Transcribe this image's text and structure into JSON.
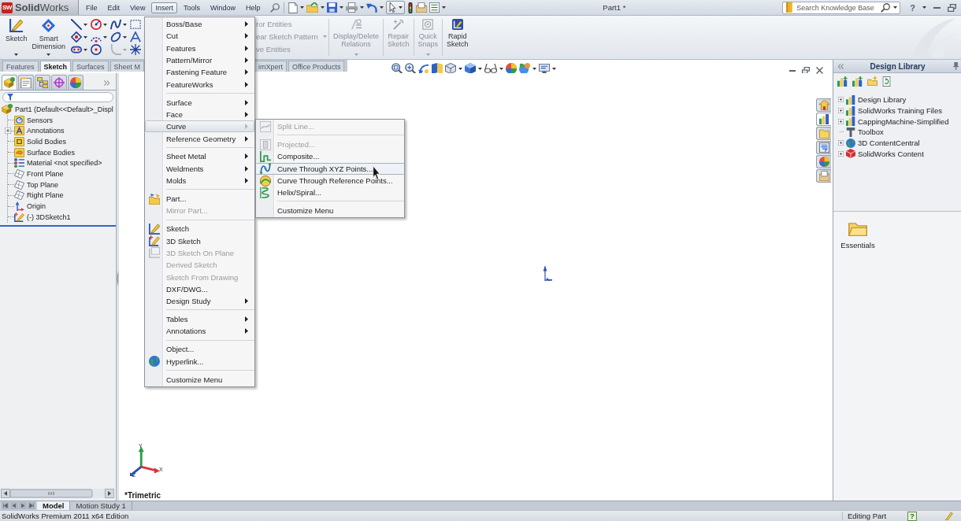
{
  "title_bar": {
    "logo_mark": "SW",
    "logo": "**Solid**Works",
    "menus": [
      {
        "label": "File",
        "selected": false
      },
      {
        "label": "Edit",
        "selected": false
      },
      {
        "label": "View",
        "selected": false
      },
      {
        "label": "Insert",
        "selected": true
      },
      {
        "label": "Tools",
        "selected": false
      },
      {
        "label": "Window",
        "selected": false
      },
      {
        "label": "Help",
        "selected": false
      }
    ],
    "document_title": "Part1 *",
    "search": {
      "placeholder": "Search Knowledge Base"
    },
    "help": "?"
  },
  "command_manager": {
    "large_buttons": [
      {
        "label": "Sketch",
        "dropdown": true
      },
      {
        "label": "Smart Dimension",
        "dropdown": true
      }
    ],
    "partial_commands": [
      {
        "label": "ror Entities",
        "disabled": true,
        "dropdown": false
      },
      {
        "label": "ear Sketch Pattern",
        "disabled": true,
        "dropdown": true
      },
      {
        "label": "ve Entities",
        "disabled": true,
        "dropdown": false
      }
    ],
    "tools": [
      {
        "label": "Display/Delete Relations",
        "disabled": true,
        "dropdown": true
      },
      {
        "label": "Repair Sketch",
        "disabled": true,
        "dropdown": false
      },
      {
        "label": "Quick Snaps",
        "disabled": true,
        "dropdown": true
      },
      {
        "label": "Rapid Sketch",
        "disabled": false,
        "dropdown": false
      }
    ]
  },
  "tabs": [
    {
      "label": "Features",
      "selected": false
    },
    {
      "label": "Sketch",
      "selected": true
    },
    {
      "label": "Surfaces",
      "selected": false
    },
    {
      "label": "Sheet M",
      "selected": false
    },
    {
      "label": "imXpert",
      "selected": false
    },
    {
      "label": "Office Products",
      "selected": false
    }
  ],
  "feature_manager": {
    "panel_tabs": [
      {
        "selected": true
      },
      {
        "selected": false
      },
      {
        "selected": false
      },
      {
        "selected": false
      },
      {
        "selected": false
      }
    ],
    "tree": {
      "label": "Part1 (Default<<Default>_Displ",
      "children": [
        {
          "label": "Sensors"
        },
        {
          "label": "Annotations",
          "expanded": false
        },
        {
          "label": "Solid Bodies"
        },
        {
          "label": "Surface Bodies"
        },
        {
          "label": "Material <not specified>"
        },
        {
          "label": "Front Plane"
        },
        {
          "label": "Top Plane"
        },
        {
          "label": "Right Plane"
        },
        {
          "label": "Origin"
        },
        {
          "label": "(-) 3DSketch1"
        }
      ]
    }
  },
  "viewport": {
    "view_name": "*Trimetric",
    "triad_axes": [
      "Y",
      "X",
      "Z"
    ]
  },
  "task_pane": {
    "tabs": [
      {
        "selected": false
      },
      {
        "selected": true
      },
      {
        "selected": false
      },
      {
        "selected": false
      },
      {
        "selected": false
      },
      {
        "selected": false
      }
    ],
    "title": "Design Library",
    "items": [
      {
        "label": "Design Library",
        "expanded": false
      },
      {
        "label": "SolidWorks Training Files",
        "expanded": false
      },
      {
        "label": "CappingMachine-Simplified",
        "expanded": false
      },
      {
        "label": "Toolbox"
      },
      {
        "label": "3D ContentCentral",
        "expanded": false
      },
      {
        "label": "SolidWorks Content",
        "expanded": false
      }
    ],
    "folders": [
      {
        "label": "Essentials"
      }
    ]
  },
  "insert_menu": {
    "groups": [
      [
        {
          "label": "Boss/Base",
          "submenu": true,
          "disabled": false,
          "selected": false
        },
        {
          "label": "Cut",
          "submenu": true,
          "disabled": false,
          "selected": false
        },
        {
          "label": "Features",
          "submenu": true,
          "disabled": false,
          "selected": false
        },
        {
          "label": "Pattern/Mirror",
          "submenu": true,
          "disabled": false,
          "selected": false
        },
        {
          "label": "Fastening Feature",
          "submenu": true,
          "disabled": false,
          "selected": false
        },
        {
          "label": "FeatureWorks",
          "submenu": true,
          "disabled": false,
          "selected": false
        }
      ],
      [
        {
          "label": "Surface",
          "submenu": true,
          "disabled": false,
          "selected": false
        },
        {
          "label": "Face",
          "submenu": true,
          "disabled": false,
          "selected": false
        },
        {
          "label": "Curve",
          "submenu": true,
          "disabled": false,
          "selected": true
        },
        {
          "label": "Reference Geometry",
          "submenu": true,
          "disabled": false,
          "selected": false
        }
      ],
      [
        {
          "label": "Sheet Metal",
          "submenu": true,
          "disabled": false,
          "selected": false
        },
        {
          "label": "Weldments",
          "submenu": true,
          "disabled": false,
          "selected": false
        },
        {
          "label": "Molds",
          "submenu": true,
          "disabled": false,
          "selected": false
        }
      ],
      [
        {
          "label": "Part...",
          "submenu": false,
          "disabled": false,
          "selected": false
        },
        {
          "label": "Mirror Part...",
          "submenu": false,
          "disabled": true,
          "selected": false
        }
      ],
      [
        {
          "label": "Sketch",
          "submenu": false,
          "disabled": false,
          "selected": false
        },
        {
          "label": "3D Sketch",
          "submenu": false,
          "disabled": false,
          "selected": false
        },
        {
          "label": "3D Sketch On Plane",
          "submenu": false,
          "disabled": true,
          "selected": false
        },
        {
          "label": "Derived Sketch",
          "submenu": false,
          "disabled": true,
          "selected": false
        },
        {
          "label": "Sketch From Drawing",
          "submenu": false,
          "disabled": true,
          "selected": false
        },
        {
          "label": "DXF/DWG...",
          "submenu": false,
          "disabled": false,
          "selected": false
        },
        {
          "label": "Design Study",
          "submenu": true,
          "disabled": false,
          "selected": false
        }
      ],
      [
        {
          "label": "Tables",
          "submenu": true,
          "disabled": false,
          "selected": false
        },
        {
          "label": "Annotations",
          "submenu": true,
          "disabled": false,
          "selected": false
        }
      ],
      [
        {
          "label": "Object...",
          "submenu": false,
          "disabled": false,
          "selected": false
        },
        {
          "label": "Hyperlink...",
          "submenu": false,
          "disabled": false,
          "selected": false
        }
      ],
      [
        {
          "label": "Customize Menu",
          "submenu": false,
          "disabled": false,
          "selected": false
        }
      ]
    ]
  },
  "curve_submenu": {
    "groups": [
      [
        {
          "label": "Split Line...",
          "submenu": false,
          "disabled": true,
          "selected": false
        }
      ],
      [
        {
          "label": "Projected...",
          "submenu": false,
          "disabled": true,
          "selected": false
        },
        {
          "label": "Composite...",
          "submenu": false,
          "disabled": false,
          "selected": false
        },
        {
          "label": "Curve Through XYZ Points...",
          "submenu": false,
          "disabled": false,
          "selected": true
        },
        {
          "label": "Curve Through Reference Points...",
          "submenu": false,
          "disabled": false,
          "selected": false
        },
        {
          "label": "Helix/Spiral...",
          "submenu": false,
          "disabled": false,
          "selected": false
        }
      ],
      [
        {
          "label": "Customize Menu",
          "submenu": false,
          "disabled": false,
          "selected": false
        }
      ]
    ]
  },
  "bottom_tabs": [
    {
      "label": "Model",
      "selected": true
    },
    {
      "label": "Motion Study 1",
      "selected": false
    }
  ],
  "status_bar": {
    "edition": "SolidWorks Premium 2011 x64 Edition",
    "mode": "Editing Part",
    "help": "?"
  }
}
